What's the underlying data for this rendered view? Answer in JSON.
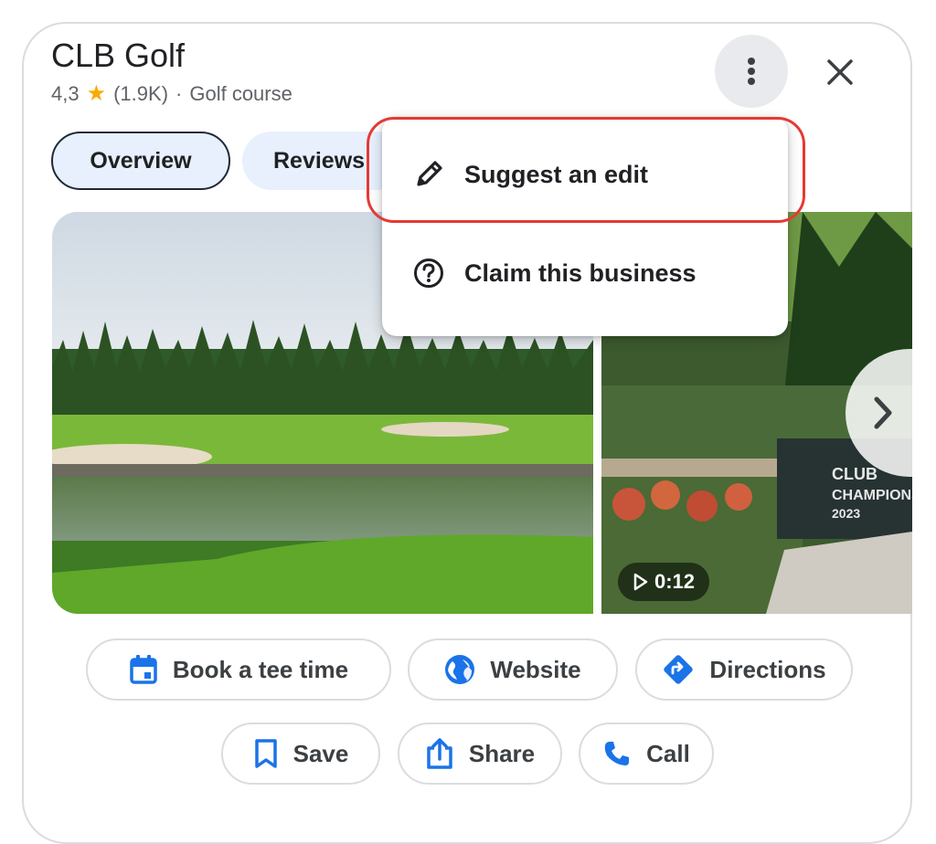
{
  "place": {
    "name": "CLB Golf",
    "rating": "4,3",
    "review_count": "(1.9K)",
    "separator": "·",
    "category": "Golf course"
  },
  "tabs": [
    {
      "label": "Overview",
      "selected": true
    },
    {
      "label": "Reviews",
      "selected": false
    }
  ],
  "header_icons": {
    "more": "more-vert-icon",
    "close": "close-icon"
  },
  "menu": {
    "items": [
      {
        "label": "Suggest an edit",
        "icon": "pencil-icon",
        "highlighted": true
      },
      {
        "label": "Claim this business",
        "icon": "help-circle-icon",
        "highlighted": false
      }
    ]
  },
  "media": {
    "video_duration": "0:12",
    "sign_text_line1": "CLUB",
    "sign_text_line2": "CHAMPIONSHIP",
    "sign_text_line3": "2023"
  },
  "actions": {
    "row1": [
      {
        "label": "Book a tee time",
        "icon": "calendar-icon"
      },
      {
        "label": "Website",
        "icon": "globe-icon"
      },
      {
        "label": "Directions",
        "icon": "directions-icon"
      }
    ],
    "row2": [
      {
        "label": "Save",
        "icon": "bookmark-icon"
      },
      {
        "label": "Share",
        "icon": "share-icon"
      },
      {
        "label": "Call",
        "icon": "phone-icon"
      }
    ]
  },
  "colors": {
    "accent": "#1a73e8",
    "highlight": "#e53935",
    "star": "#f9ab00"
  }
}
